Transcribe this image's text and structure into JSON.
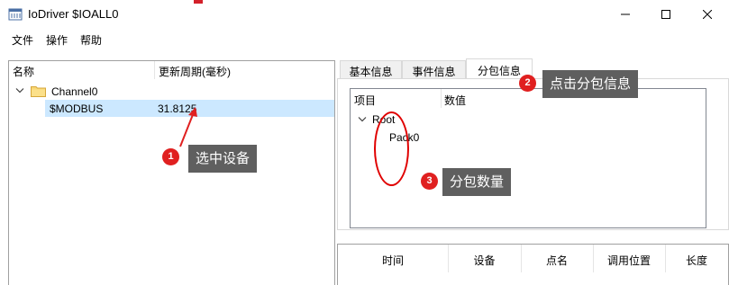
{
  "window": {
    "title": "IoDriver $IOALL0",
    "icon": "app-window-icon",
    "controls": {
      "minimize": "minimize-icon",
      "maximize": "maximize-icon",
      "close": "close-icon"
    }
  },
  "menu": {
    "items": [
      {
        "label": "文件"
      },
      {
        "label": "操作"
      },
      {
        "label": "帮助"
      }
    ]
  },
  "device_tree": {
    "columns": {
      "name": "名称",
      "period": "更新周期(毫秒)"
    },
    "channel": {
      "label": "Channel0",
      "expanded": true,
      "icon": "folder-icon"
    },
    "device": {
      "label": "$MODBUS",
      "period": "31.8125",
      "selected": true
    }
  },
  "tabs": {
    "items": [
      {
        "label": "基本信息"
      },
      {
        "label": "事件信息"
      },
      {
        "label": "分包信息",
        "active": true
      }
    ]
  },
  "packet_grid": {
    "columns": {
      "item": "项目",
      "value": "数值"
    },
    "root": {
      "label": "Root",
      "expanded": true
    },
    "children": [
      {
        "label": "Pack0"
      }
    ]
  },
  "event_grid": {
    "columns": [
      "时间",
      "设备",
      "点名",
      "调用位置",
      "长度"
    ]
  },
  "annotations": {
    "step1": {
      "number": "1",
      "text": "选中设备"
    },
    "step2": {
      "number": "2",
      "text": "点击分包信息"
    },
    "step3": {
      "number": "3",
      "text": "分包数量"
    },
    "colors": {
      "badge": "#e02020",
      "callout": "#5f5f5f",
      "highlight": "#cce8ff"
    }
  }
}
